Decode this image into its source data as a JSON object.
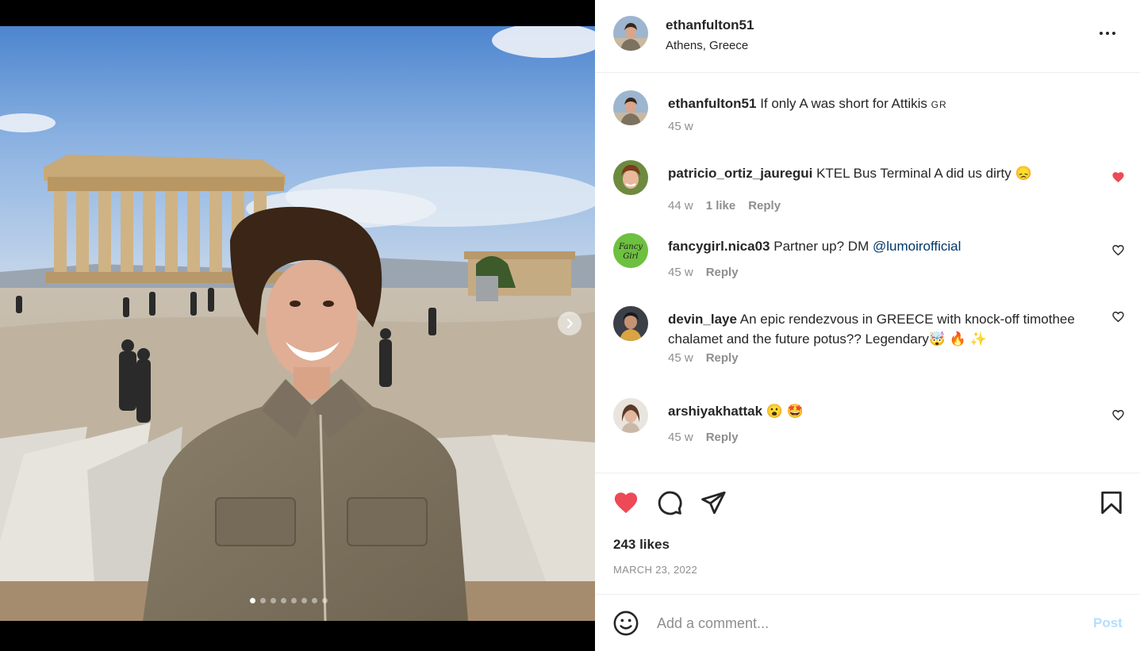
{
  "post": {
    "username": "ethanfulton51",
    "location": "Athens, Greece",
    "carousel": {
      "slide_count": 8,
      "active_slide": 1
    },
    "caption": {
      "username": "ethanfulton51",
      "text": "If only A was short for Attikis",
      "flag": "GR",
      "time": "45 w"
    },
    "comments": [
      {
        "username": "patricio_ortiz_jauregui",
        "text": "KTEL Bus Terminal A did us dirty 😞",
        "time": "44 w",
        "likes": "1 like",
        "reply": "Reply",
        "liked": true
      },
      {
        "username": "fancygirl.nica03",
        "text": "Partner up? DM",
        "mention": "@lumoirofficial",
        "time": "45 w",
        "reply": "Reply",
        "liked": false,
        "avatar_text": [
          "Fancy",
          "Girl"
        ]
      },
      {
        "username": "devin_laye",
        "text": "An epic rendezvous in GREECE with knock-off timothee chalamet and the future potus?? Legendary🤯 🔥 ✨",
        "time": "45 w",
        "reply": "Reply",
        "liked": false
      },
      {
        "username": "arshiyakhattak",
        "text": "😮 🤩",
        "time": "45 w",
        "reply": "Reply",
        "liked": false
      }
    ],
    "likes": "243 likes",
    "date": "MARCH 23, 2022",
    "comment_placeholder": "Add a comment...",
    "post_button": "Post"
  },
  "icons": {
    "like": "heart-icon",
    "comment": "comment-icon",
    "share": "send-icon",
    "save": "bookmark-icon",
    "emoji": "emoji-icon",
    "more": "more-horizontal-icon",
    "next": "chevron-right-icon"
  },
  "colors": {
    "liked_heart": "#ed4956",
    "mention": "#00376b",
    "muted": "#8e8e8e",
    "post_button_disabled": "#b2dffc"
  }
}
